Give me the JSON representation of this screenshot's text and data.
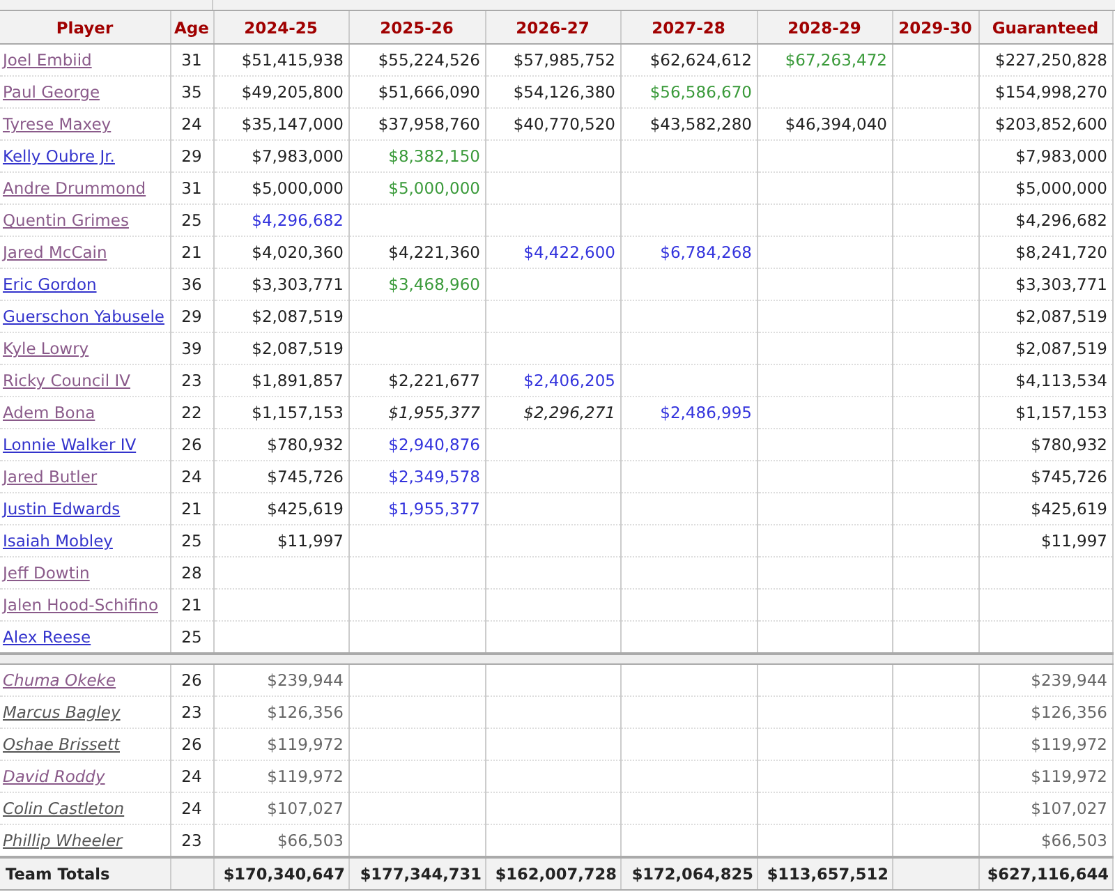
{
  "table": {
    "columns": [
      "Player",
      "Age",
      "2024-25",
      "2025-26",
      "2026-27",
      "2027-28",
      "2028-29",
      "2029-30",
      "Guaranteed"
    ],
    "sections": [
      {
        "kind": "standard",
        "rows": [
          {
            "player": "Joel Embiid",
            "visited": true,
            "age": "31",
            "cells": [
              {
                "text": "$51,415,938",
                "kind": "guaranteed"
              },
              {
                "text": "$55,224,526",
                "kind": "guaranteed"
              },
              {
                "text": "$57,985,752",
                "kind": "guaranteed"
              },
              {
                "text": "$62,624,612",
                "kind": "guaranteed"
              },
              {
                "text": "$67,263,472",
                "kind": "player_option"
              },
              null
            ],
            "guaranteed": "$227,250,828"
          },
          {
            "player": "Paul George",
            "visited": true,
            "age": "35",
            "cells": [
              {
                "text": "$49,205,800",
                "kind": "guaranteed"
              },
              {
                "text": "$51,666,090",
                "kind": "guaranteed"
              },
              {
                "text": "$54,126,380",
                "kind": "guaranteed"
              },
              {
                "text": "$56,586,670",
                "kind": "player_option"
              },
              null,
              null
            ],
            "guaranteed": "$154,998,270"
          },
          {
            "player": "Tyrese Maxey",
            "visited": true,
            "age": "24",
            "cells": [
              {
                "text": "$35,147,000",
                "kind": "guaranteed"
              },
              {
                "text": "$37,958,760",
                "kind": "guaranteed"
              },
              {
                "text": "$40,770,520",
                "kind": "guaranteed"
              },
              {
                "text": "$43,582,280",
                "kind": "guaranteed"
              },
              {
                "text": "$46,394,040",
                "kind": "guaranteed"
              },
              null
            ],
            "guaranteed": "$203,852,600"
          },
          {
            "player": "Kelly Oubre Jr.",
            "visited": false,
            "age": "29",
            "cells": [
              {
                "text": "$7,983,000",
                "kind": "guaranteed"
              },
              {
                "text": "$8,382,150",
                "kind": "player_option"
              },
              null,
              null,
              null,
              null
            ],
            "guaranteed": "$7,983,000"
          },
          {
            "player": "Andre Drummond",
            "visited": true,
            "age": "31",
            "cells": [
              {
                "text": "$5,000,000",
                "kind": "guaranteed"
              },
              {
                "text": "$5,000,000",
                "kind": "player_option"
              },
              null,
              null,
              null,
              null
            ],
            "guaranteed": "$5,000,000"
          },
          {
            "player": "Quentin Grimes",
            "visited": true,
            "age": "25",
            "cells": [
              {
                "text": "$4,296,682",
                "kind": "team_option"
              },
              null,
              null,
              null,
              null,
              null
            ],
            "guaranteed": "$4,296,682"
          },
          {
            "player": "Jared McCain",
            "visited": true,
            "age": "21",
            "cells": [
              {
                "text": "$4,020,360",
                "kind": "guaranteed"
              },
              {
                "text": "$4,221,360",
                "kind": "guaranteed"
              },
              {
                "text": "$4,422,600",
                "kind": "team_option"
              },
              {
                "text": "$6,784,268",
                "kind": "team_option"
              },
              null,
              null
            ],
            "guaranteed": "$8,241,720"
          },
          {
            "player": "Eric Gordon",
            "visited": false,
            "age": "36",
            "cells": [
              {
                "text": "$3,303,771",
                "kind": "guaranteed"
              },
              {
                "text": "$3,468,960",
                "kind": "player_option"
              },
              null,
              null,
              null,
              null
            ],
            "guaranteed": "$3,303,771"
          },
          {
            "player": "Guerschon Yabusele",
            "visited": false,
            "age": "29",
            "cells": [
              {
                "text": "$2,087,519",
                "kind": "guaranteed"
              },
              null,
              null,
              null,
              null,
              null
            ],
            "guaranteed": "$2,087,519"
          },
          {
            "player": "Kyle Lowry",
            "visited": true,
            "age": "39",
            "cells": [
              {
                "text": "$2,087,519",
                "kind": "guaranteed"
              },
              null,
              null,
              null,
              null,
              null
            ],
            "guaranteed": "$2,087,519"
          },
          {
            "player": "Ricky Council IV",
            "visited": true,
            "age": "23",
            "cells": [
              {
                "text": "$1,891,857",
                "kind": "guaranteed"
              },
              {
                "text": "$2,221,677",
                "kind": "guaranteed"
              },
              {
                "text": "$2,406,205",
                "kind": "team_option"
              },
              null,
              null,
              null
            ],
            "guaranteed": "$4,113,534"
          },
          {
            "player": "Adem Bona",
            "visited": true,
            "age": "22",
            "cells": [
              {
                "text": "$1,157,153",
                "kind": "guaranteed"
              },
              {
                "text": "$1,955,377",
                "kind": "non_guaranteed"
              },
              {
                "text": "$2,296,271",
                "kind": "non_guaranteed"
              },
              {
                "text": "$2,486,995",
                "kind": "team_option"
              },
              null,
              null
            ],
            "guaranteed": "$1,157,153"
          },
          {
            "player": "Lonnie Walker IV",
            "visited": false,
            "age": "26",
            "cells": [
              {
                "text": "$780,932",
                "kind": "guaranteed"
              },
              {
                "text": "$2,940,876",
                "kind": "team_option"
              },
              null,
              null,
              null,
              null
            ],
            "guaranteed": "$780,932"
          },
          {
            "player": "Jared Butler",
            "visited": true,
            "age": "24",
            "cells": [
              {
                "text": "$745,726",
                "kind": "guaranteed"
              },
              {
                "text": "$2,349,578",
                "kind": "team_option"
              },
              null,
              null,
              null,
              null
            ],
            "guaranteed": "$745,726"
          },
          {
            "player": "Justin Edwards",
            "visited": false,
            "age": "21",
            "cells": [
              {
                "text": "$425,619",
                "kind": "guaranteed"
              },
              {
                "text": "$1,955,377",
                "kind": "team_option"
              },
              null,
              null,
              null,
              null
            ],
            "guaranteed": "$425,619"
          },
          {
            "player": "Isaiah Mobley",
            "visited": false,
            "age": "25",
            "cells": [
              {
                "text": "$11,997",
                "kind": "guaranteed"
              },
              null,
              null,
              null,
              null,
              null
            ],
            "guaranteed": "$11,997"
          },
          {
            "player": "Jeff Dowtin",
            "visited": true,
            "age": "28",
            "cells": [
              null,
              null,
              null,
              null,
              null,
              null
            ]
          },
          {
            "player": "Jalen Hood-Schifino",
            "visited": true,
            "age": "21",
            "cells": [
              null,
              null,
              null,
              null,
              null,
              null
            ]
          },
          {
            "player": "Alex Reese",
            "visited": false,
            "age": "25",
            "cells": [
              null,
              null,
              null,
              null,
              null,
              null
            ]
          }
        ]
      },
      {
        "kind": "two_way",
        "rows": [
          {
            "player": "Chuma Okeke",
            "visited": true,
            "age": "26",
            "cells": [
              {
                "text": "$239,944",
                "kind": "guaranteed"
              },
              null,
              null,
              null,
              null,
              null
            ],
            "guaranteed": "$239,944"
          },
          {
            "player": "Marcus Bagley",
            "visited": false,
            "age": "23",
            "cells": [
              {
                "text": "$126,356",
                "kind": "guaranteed"
              },
              null,
              null,
              null,
              null,
              null
            ],
            "guaranteed": "$126,356"
          },
          {
            "player": "Oshae Brissett",
            "visited": false,
            "age": "26",
            "cells": [
              {
                "text": "$119,972",
                "kind": "guaranteed"
              },
              null,
              null,
              null,
              null,
              null
            ],
            "guaranteed": "$119,972"
          },
          {
            "player": "David Roddy",
            "visited": true,
            "age": "24",
            "cells": [
              {
                "text": "$119,972",
                "kind": "guaranteed"
              },
              null,
              null,
              null,
              null,
              null
            ],
            "guaranteed": "$119,972"
          },
          {
            "player": "Colin Castleton",
            "visited": false,
            "age": "24",
            "cells": [
              {
                "text": "$107,027",
                "kind": "guaranteed"
              },
              null,
              null,
              null,
              null,
              null
            ],
            "guaranteed": "$107,027"
          },
          {
            "player": "Phillip Wheeler",
            "visited": false,
            "age": "23",
            "cells": [
              {
                "text": "$66,503",
                "kind": "guaranteed"
              },
              null,
              null,
              null,
              null,
              null
            ],
            "guaranteed": "$66,503"
          }
        ]
      }
    ],
    "totals": {
      "label": "Team Totals",
      "cells": [
        "$170,340,647",
        "$177,344,731",
        "$162,007,728",
        "$172,064,825",
        "$113,657,512",
        null
      ],
      "guaranteed": "$627,116,644"
    }
  }
}
